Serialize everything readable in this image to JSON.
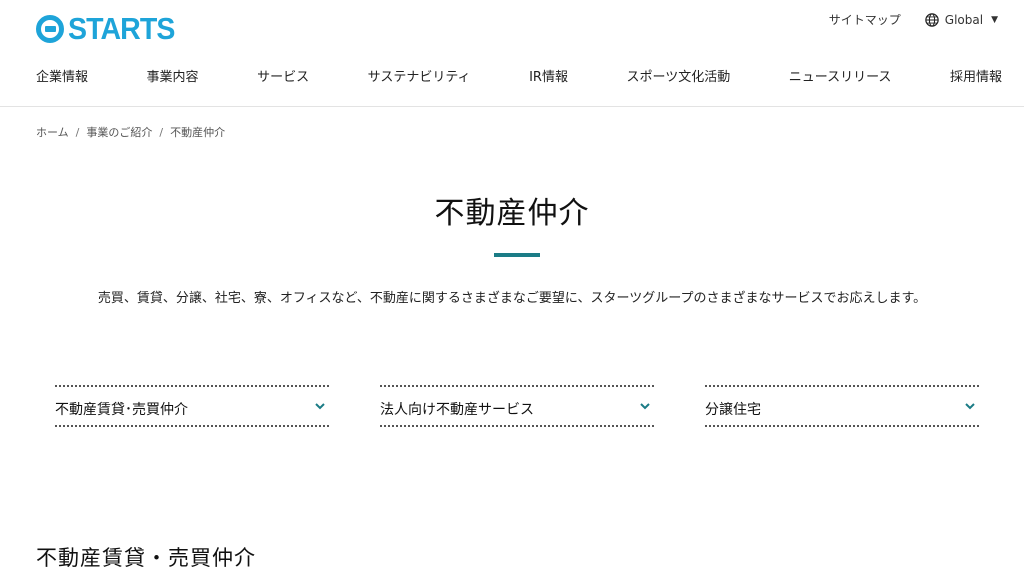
{
  "brand": {
    "logo_text": "STARTS"
  },
  "header": {
    "sitemap": "サイトマップ",
    "global": "Global",
    "nav": [
      "企業情報",
      "事業内容",
      "サービス",
      "サステナビリティ",
      "IR情報",
      "スポーツ文化活動",
      "ニュースリリース",
      "採用情報"
    ]
  },
  "breadcrumb": {
    "home": "ホーム",
    "parent": "事業のご紹介",
    "current": "不動産仲介"
  },
  "page": {
    "title": "不動産仲介",
    "lead": "売買、賃貸、分譲、社宅、寮、オフィスなど、不動産に関するさまざまなご要望に、スターツグループのさまざまなサービスでお応えします。"
  },
  "cards": [
    {
      "label": "不動産賃貸･売買仲介"
    },
    {
      "label": "法人向け不動産サービス"
    },
    {
      "label": "分譲住宅"
    }
  ],
  "section": {
    "title": "不動産賃貸・売買仲介"
  },
  "colors": {
    "brand": "#1ea4d9",
    "accent": "#1b7c86",
    "text": "#222222"
  }
}
